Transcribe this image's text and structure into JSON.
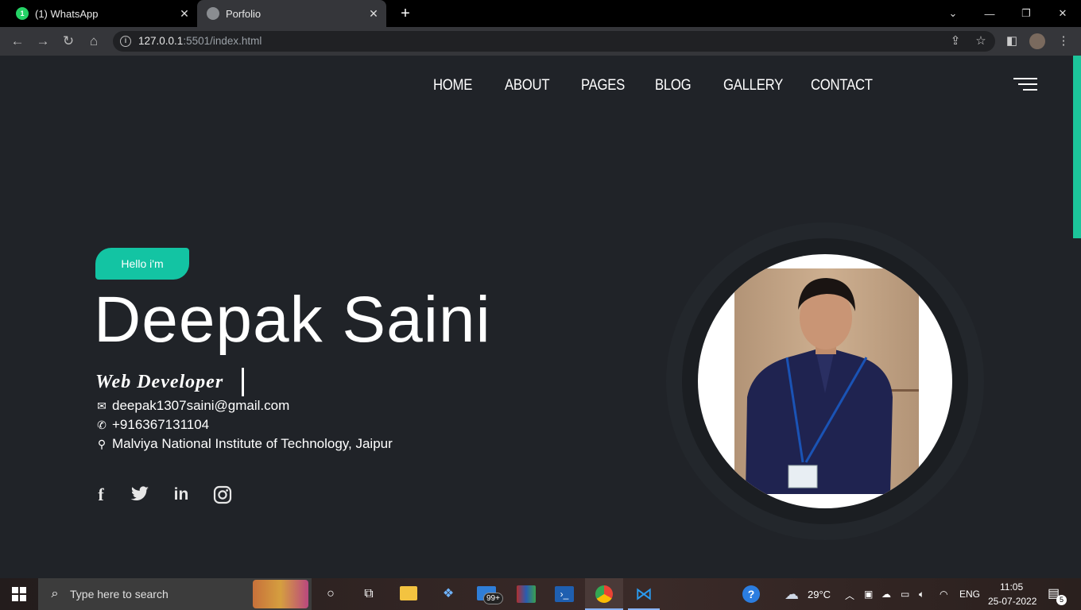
{
  "browser": {
    "tabs": [
      {
        "label": "(1) WhatsApp",
        "badge": "1"
      },
      {
        "label": "Porfolio"
      }
    ],
    "url_host": "127.0.0.1",
    "url_rest": ":5501/index.html"
  },
  "nav": {
    "links": [
      "HOME",
      "ABOUT",
      "PAGES",
      "BLOG",
      "GALLERY",
      "CONTACT"
    ]
  },
  "hero": {
    "greeting": "Hello i'm",
    "name": "Deepak Saini",
    "role": "Web Developer",
    "email": "deepak1307saini@gmail.com",
    "phone": "+916367131104",
    "location": "Malviya National Institute of Technology, Jaipur",
    "accent_color": "#13c4a3"
  },
  "taskbar": {
    "search_placeholder": "Type here to search",
    "mail_badge": "99+",
    "weather": "29°C",
    "language": "ENG",
    "time": "11:05",
    "date": "25-07-2022",
    "notifications": "5"
  }
}
